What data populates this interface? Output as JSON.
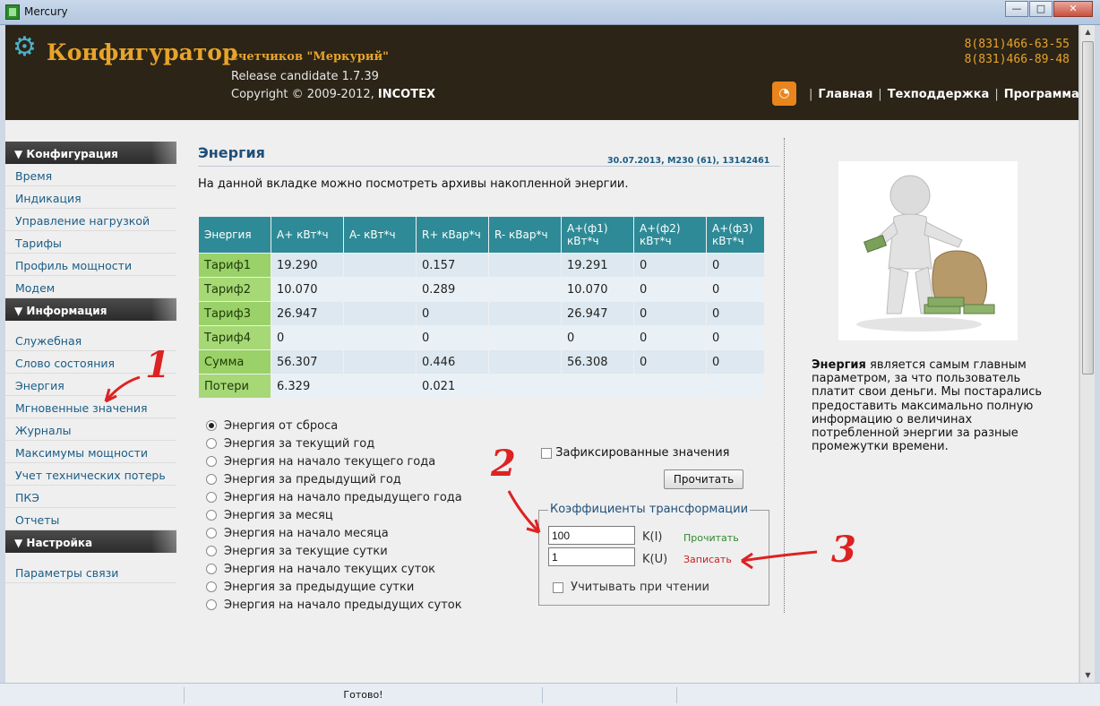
{
  "window": {
    "title": "Mercury",
    "btn_min": "—",
    "btn_max": "□",
    "btn_close": "✕"
  },
  "header": {
    "logo": "Конфигуратор",
    "logo_sub": "счетчиков \"Меркурий\"",
    "release": "Release candidate 1.7.39",
    "copyright_prefix": "Copyright © 2009-2012, ",
    "copyright_company": "INCOTEX",
    "phones": [
      "8(831)466-63-55",
      "8(831)466-89-48"
    ],
    "nav": [
      "Главная",
      "Техподдержка",
      "Программа"
    ],
    "separator": "|"
  },
  "sidebar": {
    "sections": [
      {
        "title": "▼ Конфигурация",
        "items": [
          "Время",
          "Индикация",
          "Управление нагрузкой",
          "Тарифы",
          "Профиль мощности",
          "Модем"
        ]
      },
      {
        "title": "▼ Информация",
        "items": [
          "Служебная",
          "Слово состояния",
          "Энергия",
          "Мгновенные значения",
          "Журналы",
          "Максимумы мощности",
          "Учет технических потерь",
          "ПКЭ",
          "Отчеты"
        ]
      },
      {
        "title": "▼ Настройка",
        "items": [
          "Параметры связи"
        ]
      }
    ]
  },
  "main": {
    "title": "Энергия",
    "meta": "30.07.2013, M230 (61), 13142461",
    "description": "На данной вкладке можно посмотреть архивы накопленной энергии."
  },
  "table": {
    "headers": [
      "Энергия",
      "A+ кВт*ч",
      "A- кВт*ч",
      "R+ кВар*ч",
      "R- кВар*ч",
      "A+(ф1) кВт*ч",
      "A+(ф2) кВт*ч",
      "A+(ф3) кВт*ч"
    ],
    "rows": [
      [
        "Тариф1",
        "19.290",
        "",
        "0.157",
        "",
        "19.291",
        "0",
        "0"
      ],
      [
        "Тариф2",
        "10.070",
        "",
        "0.289",
        "",
        "10.070",
        "0",
        "0"
      ],
      [
        "Тариф3",
        "26.947",
        "",
        "0",
        "",
        "26.947",
        "0",
        "0"
      ],
      [
        "Тариф4",
        "0",
        "",
        "0",
        "",
        "0",
        "0",
        "0"
      ],
      [
        "Сумма",
        "56.307",
        "",
        "0.446",
        "",
        "56.308",
        "0",
        "0"
      ],
      [
        "Потери",
        "6.329",
        "",
        "0.021",
        "",
        "",
        "",
        ""
      ]
    ]
  },
  "modes": {
    "selected": 0,
    "options": [
      "Энергия от сброса",
      "Энергия за текущий год",
      "Энергия на начало текущего года",
      "Энергия за предыдущий год",
      "Энергия на начало предыдущего года",
      "Энергия за месяц",
      "Энергия на начало месяца",
      "Энергия за текущие сутки",
      "Энергия на начало текущих суток",
      "Энергия за предыдущие сутки",
      "Энергия на начало предыдущих суток"
    ]
  },
  "controls": {
    "fixed_label": "Зафиксированные значения",
    "read_button": "Прочитать"
  },
  "coef": {
    "legend": "Коэффициенты трансформации",
    "ki_value": "100",
    "ku_value": "1",
    "ki_label": "K(I)",
    "ku_label": "K(U)",
    "read_link": "Прочитать",
    "write_link": "Записать",
    "apply_label": "Учитывать при чтении",
    "read_color": "#2f8a2f",
    "write_color": "#c82020"
  },
  "right_panel": {
    "bold": "Энергия",
    "text": " является самым главным параметром, за что пользователь платит свои деньги. Мы постарались предоставить максимально полную информацию о величинах потребленной энергии за разные промежутки времени."
  },
  "annotations": [
    "1",
    "2",
    "3"
  ],
  "status": {
    "text": "Готово!"
  }
}
